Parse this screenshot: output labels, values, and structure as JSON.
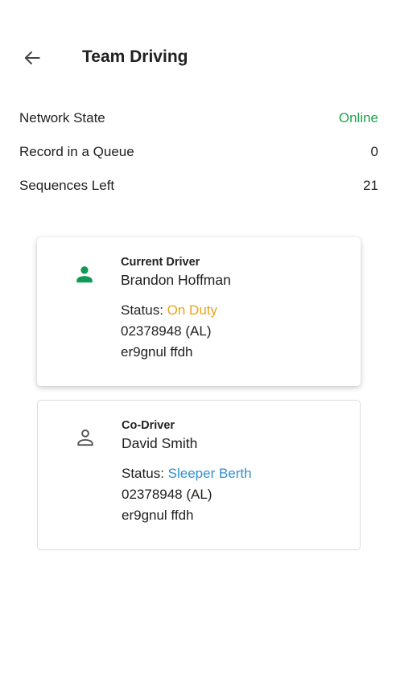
{
  "header": {
    "title": "Team Driving",
    "back_icon": "arrow-left-icon"
  },
  "stats": [
    {
      "label": "Network State",
      "value": "Online"
    },
    {
      "label": "Record in a Queue",
      "value": "0"
    },
    {
      "label": "Sequences Left",
      "value": "21"
    }
  ],
  "drivers": [
    {
      "role": "Current Driver",
      "name": "Brandon Hoffman",
      "status_label": "Status: ",
      "status_value": "On Duty",
      "license": "02378948 (AL)",
      "extra": "er9gnul ffdh",
      "icon": "person-filled-icon"
    },
    {
      "role": "Co-Driver",
      "name": "David Smith",
      "status_label": "Status: ",
      "status_value": "Sleeper Berth",
      "license": "02378948 (AL)",
      "extra": "er9gnul ffdh",
      "icon": "person-outline-icon"
    }
  ],
  "colors": {
    "online": "#1ea34d",
    "on_duty": "#e8a317",
    "sleeper_berth": "#2f8fcf",
    "active_driver_icon": "#109a56"
  }
}
